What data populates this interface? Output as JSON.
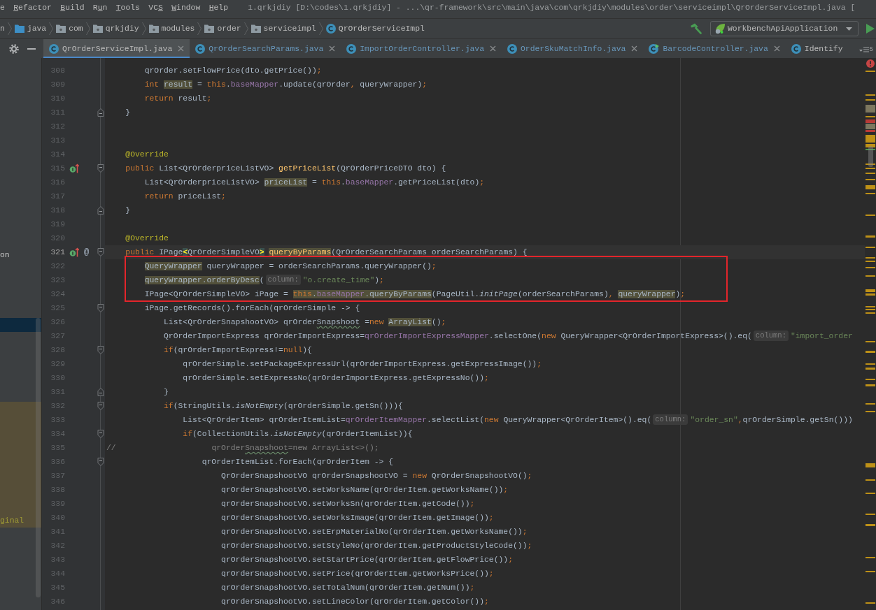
{
  "menu_bar": {
    "items": [
      {
        "before": "e"
      },
      {
        "mnemonic": "R",
        "after": "efactor"
      },
      {
        "mnemonic": "B",
        "after": "uild"
      },
      {
        "before": "R",
        "mnemonic": "u",
        "after": "n"
      },
      {
        "mnemonic": "T",
        "after": "ools"
      },
      {
        "before": "VC",
        "mnemonic": "S"
      },
      {
        "mnemonic": "W",
        "after": "indow"
      },
      {
        "mnemonic": "H",
        "after": "elp"
      }
    ]
  },
  "window": {
    "title": "1.qrkjdiy [D:\\codes\\1.qrkjdiy] - ...\\qr-framework\\src\\main\\java\\com\\qrkjdiy\\modules\\order\\serviceimpl\\QrOrderServiceImpl.java ["
  },
  "navigation_bar": {
    "breadcrumbs": [
      {
        "label": "n",
        "kind": "none"
      },
      {
        "label": "java",
        "kind": "source_root"
      },
      {
        "label": "com",
        "kind": "package"
      },
      {
        "label": "qrkjdiy",
        "kind": "package"
      },
      {
        "label": "modules",
        "kind": "package"
      },
      {
        "label": "order",
        "kind": "package"
      },
      {
        "label": "serviceimpl",
        "kind": "package"
      },
      {
        "label": "QrOrderServiceImpl",
        "kind": "class"
      }
    ],
    "run_configuration": "WorkbenchApiApplication"
  },
  "editor_tabs": {
    "tabs": [
      {
        "label": "QrOrderServiceImpl.java",
        "selected": true,
        "modified": false,
        "runnable": false,
        "closable": true
      },
      {
        "label": "QrOrderSearchParams.java",
        "selected": false,
        "modified": true,
        "runnable": false,
        "closable": true
      },
      {
        "label": "ImportOrderController.java",
        "selected": false,
        "modified": true,
        "runnable": false,
        "closable": true
      },
      {
        "label": "OrderSkuMatchInfo.java",
        "selected": false,
        "modified": true,
        "runnable": false,
        "closable": true
      },
      {
        "label": "BarcodeController.java",
        "selected": false,
        "modified": true,
        "runnable": true,
        "closable": true
      },
      {
        "label": "Identify",
        "selected": false,
        "modified": false,
        "runnable": false,
        "closable": false
      }
    ],
    "overflow_count": "5"
  },
  "project_tree": {
    "rows": [
      {
        "selected": false,
        "highlighted": false
      },
      {
        "selected": false,
        "highlighted": false
      },
      {
        "selected": false,
        "highlighted": false
      },
      {
        "selected": false,
        "highlighted": false
      },
      {
        "selected": false,
        "highlighted": false
      },
      {
        "selected": false,
        "highlighted": false
      },
      {
        "selected": false,
        "highlighted": false
      },
      {
        "selected": false,
        "highlighted": false
      },
      {
        "selected": false,
        "highlighted": false
      },
      {
        "selected": false,
        "highlighted": false
      },
      {
        "selected": false,
        "highlighted": false
      },
      {
        "selected": false,
        "highlighted": false
      },
      {
        "selected": false,
        "highlighted": false
      },
      {
        "label": "on",
        "color": "#c8c8c8",
        "selected": false,
        "highlighted": false
      },
      {
        "selected": false,
        "highlighted": false
      },
      {
        "selected": false,
        "highlighted": false
      },
      {
        "selected": false,
        "highlighted": false
      },
      {
        "selected": false,
        "highlighted": false
      },
      {
        "selected": true,
        "highlighted": false
      },
      {
        "selected": false,
        "highlighted": false
      },
      {
        "selected": false,
        "highlighted": false
      },
      {
        "selected": false,
        "highlighted": false
      },
      {
        "selected": false,
        "highlighted": false
      },
      {
        "selected": false,
        "highlighted": false
      },
      {
        "selected": false,
        "highlighted": true
      },
      {
        "selected": false,
        "highlighted": true
      },
      {
        "selected": false,
        "highlighted": true
      },
      {
        "selected": false,
        "highlighted": true
      },
      {
        "selected": false,
        "highlighted": true
      },
      {
        "selected": false,
        "highlighted": true
      },
      {
        "selected": false,
        "highlighted": true
      },
      {
        "selected": false,
        "highlighted": true
      },
      {
        "label": "ginal",
        "color": "#a09c35",
        "selected": false,
        "highlighted": true
      }
    ]
  },
  "editor": {
    "lines": [
      {
        "number": "308",
        "current": false,
        "framed": false,
        "tokens": [
          {
            "text": "        qrOrder.setFlowPrice(dto.getPrice());",
            "kind": "text"
          }
        ]
      },
      {
        "number": "309",
        "current": false,
        "framed": false,
        "tokens": [
          {
            "text": "        int",
            "kind": "keyword"
          },
          {
            "kind": "usage",
            "tokens": [
              {
                "text": " result",
                "kind": "text"
              }
            ]
          },
          {
            "text": " = ",
            "kind": "text"
          },
          {
            "text": "this",
            "kind": "keyword"
          },
          {
            "text": ".",
            "kind": "text"
          },
          {
            "text": "baseMapper",
            "kind": "field"
          },
          {
            "text": ".update(qrOrder, queryWrapper);",
            "kind": "text"
          }
        ]
      },
      {
        "number": "310",
        "current": false,
        "framed": false,
        "tokens": [
          {
            "text": "        return",
            "kind": "keyword"
          },
          {
            "text": " result;",
            "kind": "text"
          }
        ]
      },
      {
        "number": "311",
        "current": false,
        "framed": false,
        "gutter_marks": [
          {
            "kind": "fold_end"
          }
        ],
        "tokens": [
          {
            "text": "    }",
            "kind": "text"
          }
        ]
      },
      {
        "number": "312",
        "current": false,
        "framed": false
      },
      {
        "number": "313",
        "current": false,
        "framed": false
      },
      {
        "number": "314",
        "current": false,
        "framed": false,
        "tokens": [
          {
            "text": "    @Override",
            "kind": "annotation"
          }
        ]
      },
      {
        "number": "315",
        "current": false,
        "framed": false,
        "gutter_marks": [
          {
            "kind": "implements"
          },
          {
            "kind": "fold_start"
          }
        ],
        "tokens": [
          {
            "text": "    public",
            "kind": "keyword"
          },
          {
            "text": " List<QrOrderpriceListVO> ",
            "kind": "text"
          },
          {
            "text": "getPriceList",
            "kind": "method"
          },
          {
            "text": "(QrOrderPriceDTO dto) {",
            "kind": "text"
          }
        ]
      },
      {
        "number": "316",
        "current": false,
        "framed": false,
        "tokens": [
          {
            "text": "        List<QrOrderpriceListVO> ",
            "kind": "text"
          },
          {
            "kind": "usage",
            "tokens": [
              {
                "text": "priceList",
                "kind": "text"
              }
            ]
          },
          {
            "text": " = ",
            "kind": "text"
          },
          {
            "text": "this",
            "kind": "keyword"
          },
          {
            "text": ".",
            "kind": "text"
          },
          {
            "text": "baseMapper",
            "kind": "field"
          },
          {
            "text": ".getPriceList(dto);",
            "kind": "text"
          }
        ]
      },
      {
        "number": "317",
        "current": false,
        "framed": false,
        "tokens": [
          {
            "text": "        return",
            "kind": "keyword"
          },
          {
            "text": " priceList;",
            "kind": "text"
          }
        ]
      },
      {
        "number": "318",
        "current": false,
        "framed": false,
        "gutter_marks": [
          {
            "kind": "fold_end"
          }
        ],
        "tokens": [
          {
            "text": "    }",
            "kind": "text"
          }
        ]
      },
      {
        "number": "319",
        "current": false,
        "framed": false
      },
      {
        "number": "320",
        "current": false,
        "framed": false,
        "tokens": [
          {
            "text": "    @Override",
            "kind": "annotation"
          }
        ]
      },
      {
        "number": "321",
        "current": true,
        "framed": false,
        "gutter_marks": [
          {
            "kind": "implements"
          },
          {
            "kind": "symbol",
            "text": "@"
          },
          {
            "kind": "fold_start"
          }
        ],
        "tokens": [
          {
            "text": "    public",
            "kind": "keyword"
          },
          {
            "text": " IPage",
            "kind": "text"
          },
          {
            "text": "<",
            "kind": "brace"
          },
          {
            "text": "QrOrderSimpleVO",
            "kind": "text"
          },
          {
            "text": ">",
            "kind": "brace"
          },
          {
            "kind": "usage",
            "tokens": [
              {
                "text": " queryByParams",
                "kind": "method"
              }
            ]
          },
          {
            "text": "(QrOrderSearchParams orderSearchParams) {",
            "kind": "text"
          }
        ]
      },
      {
        "number": "322",
        "current": false,
        "framed": true,
        "tokens": [
          {
            "kind": "usage",
            "tokens": [
              {
                "text": "        QueryWrapper",
                "kind": "text"
              }
            ]
          },
          {
            "text": " queryWrapper = orderSearchParams.queryWrapper();",
            "kind": "text"
          }
        ]
      },
      {
        "number": "323",
        "current": false,
        "framed": true,
        "tokens": [
          {
            "kind": "usage",
            "tokens": [
              {
                "text": "        queryWrapper.orderByDesc",
                "kind": "text"
              }
            ]
          },
          {
            "text": "(",
            "kind": "text"
          },
          {
            "text": "column:",
            "kind": "hint"
          },
          {
            "text": "\"o.create_time\"",
            "kind": "string"
          },
          {
            "text": ");",
            "kind": "text"
          }
        ]
      },
      {
        "number": "324",
        "current": false,
        "framed": true,
        "tokens": [
          {
            "text": "        IPage<QrOrderSimpleVO> iPage = ",
            "kind": "text"
          },
          {
            "kind": "usage",
            "tokens": [
              {
                "text": "this",
                "kind": "keyword"
              },
              {
                "text": ".",
                "kind": "text"
              },
              {
                "text": "baseMapper",
                "kind": "field"
              },
              {
                "text": ".queryByParams",
                "kind": "text"
              }
            ]
          },
          {
            "text": "(PageUtil.",
            "kind": "text"
          },
          {
            "text": "initPage",
            "kind": "static"
          },
          {
            "text": "(orderSearchParams), ",
            "kind": "text"
          },
          {
            "kind": "usage",
            "tokens": [
              {
                "text": "queryWrapper",
                "kind": "text"
              }
            ]
          },
          {
            "text": ");",
            "kind": "text"
          }
        ]
      },
      {
        "number": "325",
        "current": false,
        "framed": false,
        "gutter_marks": [
          {
            "kind": "fold_start"
          }
        ],
        "tokens": [
          {
            "text": "        iPage.getRecords().forEach(qrOrderSimple -> {",
            "kind": "text"
          }
        ]
      },
      {
        "number": "326",
        "current": false,
        "framed": false,
        "tokens": [
          {
            "text": "            List<QrOrderSnapshootVO> qrOrder",
            "kind": "text"
          },
          {
            "text": "Snapshoot",
            "kind": "typo"
          },
          {
            "text": " =",
            "kind": "text"
          },
          {
            "text": "new",
            "kind": "keyword"
          },
          {
            "kind": "usage",
            "tokens": [
              {
                "text": " ArrayList",
                "kind": "text"
              }
            ]
          },
          {
            "text": "();",
            "kind": "text"
          }
        ]
      },
      {
        "number": "327",
        "current": false,
        "framed": false,
        "tokens": [
          {
            "text": "            QrOrderImportExpress qrOrderImportExpress=",
            "kind": "text"
          },
          {
            "text": "qrOrderImportExpressMapper",
            "kind": "field"
          },
          {
            "text": ".selectOne(",
            "kind": "text"
          },
          {
            "text": "new",
            "kind": "keyword"
          },
          {
            "text": " QueryWrapper<QrOrderImportExpress>().eq(",
            "kind": "text"
          },
          {
            "text": "column:",
            "kind": "hint"
          },
          {
            "text": "\"import_order",
            "kind": "string"
          }
        ]
      },
      {
        "number": "328",
        "current": false,
        "framed": false,
        "gutter_marks": [
          {
            "kind": "fold_start"
          }
        ],
        "tokens": [
          {
            "text": "            if",
            "kind": "keyword"
          },
          {
            "text": "(qrOrderImportExpress!=",
            "kind": "text"
          },
          {
            "text": "null",
            "kind": "keyword"
          },
          {
            "text": "){",
            "kind": "text"
          }
        ]
      },
      {
        "number": "329",
        "current": false,
        "framed": false,
        "tokens": [
          {
            "text": "                qrOrderSimple.setPackageExpressUrl(qrOrderImportExpress.getExpressImage());",
            "kind": "text"
          }
        ]
      },
      {
        "number": "330",
        "current": false,
        "framed": false,
        "tokens": [
          {
            "text": "                qrOrderSimple.setExpressNo(qrOrderImportExpress.getExpressNo());",
            "kind": "text"
          }
        ]
      },
      {
        "number": "331",
        "current": false,
        "framed": false,
        "gutter_marks": [
          {
            "kind": "fold_end"
          }
        ],
        "tokens": [
          {
            "text": "            }",
            "kind": "text"
          }
        ]
      },
      {
        "number": "332",
        "current": false,
        "framed": false,
        "gutter_marks": [
          {
            "kind": "fold_start"
          }
        ],
        "tokens": [
          {
            "text": "            if",
            "kind": "keyword"
          },
          {
            "text": "(StringUtils.",
            "kind": "text"
          },
          {
            "text": "isNotEmpty",
            "kind": "static"
          },
          {
            "text": "(qrOrderSimple.getSn())){",
            "kind": "text"
          }
        ]
      },
      {
        "number": "333",
        "current": false,
        "framed": false,
        "tokens": [
          {
            "text": "                List<QrOrderItem> qrOrderItemList=",
            "kind": "text"
          },
          {
            "text": "qrOrderItemMapper",
            "kind": "field"
          },
          {
            "text": ".selectList(",
            "kind": "text"
          },
          {
            "text": "new",
            "kind": "keyword"
          },
          {
            "text": " QueryWrapper<QrOrderItem>().eq(",
            "kind": "text"
          },
          {
            "text": "column:",
            "kind": "hint"
          },
          {
            "text": "\"order_sn\"",
            "kind": "string"
          },
          {
            "text": ",qrOrderSimple.getSn()))",
            "kind": "text"
          }
        ]
      },
      {
        "number": "334",
        "current": false,
        "framed": false,
        "gutter_marks": [
          {
            "kind": "fold_start"
          }
        ],
        "tokens": [
          {
            "text": "                if",
            "kind": "keyword"
          },
          {
            "text": "(CollectionUtils.",
            "kind": "text"
          },
          {
            "text": "isNotEmpty",
            "kind": "static"
          },
          {
            "text": "(qrOrderItemList)){",
            "kind": "text"
          }
        ]
      },
      {
        "number": "335",
        "current": false,
        "framed": false,
        "tokens": [
          {
            "text": "//                    qrOrder",
            "kind": "comment"
          },
          {
            "text": "Snapshoot",
            "kind": "comment_typo"
          },
          {
            "text": "=new ArrayList<>();",
            "kind": "comment"
          }
        ]
      },
      {
        "number": "336",
        "current": false,
        "framed": false,
        "gutter_marks": [
          {
            "kind": "fold_start"
          }
        ],
        "tokens": [
          {
            "text": "                    qrOrderItemList.forEach(qrOrderItem -> {",
            "kind": "text"
          }
        ]
      },
      {
        "number": "337",
        "current": false,
        "framed": false,
        "tokens": [
          {
            "text": "                        QrOrderSnapshootVO qrOrderSnapshootVO = ",
            "kind": "text"
          },
          {
            "text": "new",
            "kind": "keyword"
          },
          {
            "text": " QrOrderSnapshootVO();",
            "kind": "text"
          }
        ]
      },
      {
        "number": "338",
        "current": false,
        "framed": false,
        "tokens": [
          {
            "text": "                        qrOrderSnapshootVO.setWorksName(qrOrderItem.getWorksName());",
            "kind": "text"
          }
        ]
      },
      {
        "number": "339",
        "current": false,
        "framed": false,
        "tokens": [
          {
            "text": "                        qrOrderSnapshootVO.setWorksSn(qrOrderItem.getCode());",
            "kind": "text"
          }
        ]
      },
      {
        "number": "340",
        "current": false,
        "framed": false,
        "tokens": [
          {
            "text": "                        qrOrderSnapshootVO.setWorksImage(qrOrderItem.getImage());",
            "kind": "text"
          }
        ]
      },
      {
        "number": "341",
        "current": false,
        "framed": false,
        "tokens": [
          {
            "text": "                        qrOrderSnapshootVO.setErpMaterialNo(qrOrderItem.getWorksName());",
            "kind": "text"
          }
        ]
      },
      {
        "number": "342",
        "current": false,
        "framed": false,
        "tokens": [
          {
            "text": "                        qrOrderSnapshootVO.setStyleNo(qrOrderItem.getProductStyleCode());",
            "kind": "text"
          }
        ]
      },
      {
        "number": "343",
        "current": false,
        "framed": false,
        "tokens": [
          {
            "text": "                        qrOrderSnapshootVO.setStartPrice(qrOrderItem.getFlowPrice());",
            "kind": "text"
          }
        ]
      },
      {
        "number": "344",
        "current": false,
        "framed": false,
        "tokens": [
          {
            "text": "                        qrOrderSnapshootVO.setPrice(qrOrderItem.getWorksPrice());",
            "kind": "text"
          }
        ]
      },
      {
        "number": "345",
        "current": false,
        "framed": false,
        "tokens": [
          {
            "text": "                        qrOrderSnapshootVO.setTotalNum(qrOrderItem.getNum());",
            "kind": "text"
          }
        ]
      },
      {
        "number": "346",
        "current": false,
        "framed": false,
        "tokens": [
          {
            "text": "                        qrOrderSnapshootVO.setLineColor(qrOrderItem.getColor());",
            "kind": "text"
          }
        ]
      }
    ]
  }
}
